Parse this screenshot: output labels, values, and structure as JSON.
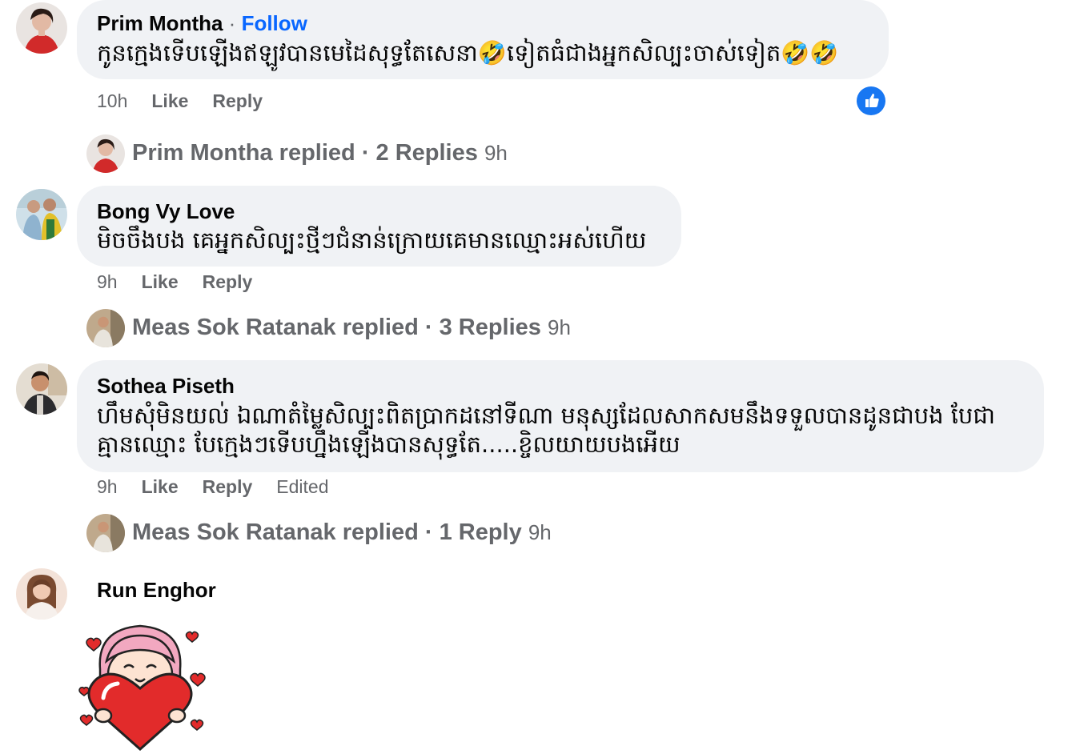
{
  "comments": [
    {
      "author": "Prim Montha",
      "follow_label": "Follow",
      "text": "កូនក្មេងទើបឡើងឥឡូវបានមេដៃសុទ្ធតែសេនា🤣ទៀតធំជាងអ្នកសិល្បះចាស់ទៀត🤣🤣",
      "time": "10h",
      "like_label": "Like",
      "reply_label": "Reply",
      "reaction": "like-icon",
      "replied_summary": "Prim Montha replied · 2 Replies",
      "replied_time": "9h"
    },
    {
      "author": "Bong Vy Love",
      "text": "មិចចឹងបង គេអ្នកសិល្បះថ្មីៗជំនាន់ក្រោយគេមានឈ្មោះអស់ហើយ",
      "time": "9h",
      "like_label": "Like",
      "reply_label": "Reply",
      "replied_summary": "Meas Sok Ratanak replied · 3 Replies",
      "replied_time": "9h"
    },
    {
      "author": "Sothea Piseth",
      "text_line1": "ហឹមសុំមិនយល់ ឯណាតំម្លៃសិល្បះពិតប្រាកដនៅទីណា មនុស្សដែលសាកសមនឹងទទួលបានដូនជាបង បែជា",
      "text_line2": "គ្មានឈ្មោះ បែក្មេងៗទើបហ្នឹងឡើងបានសុទ្ធតែ.....ខ្ចិលយាយបងអើយ",
      "time": "9h",
      "like_label": "Like",
      "reply_label": "Reply",
      "edited_label": "Edited",
      "replied_summary": "Meas Sok Ratanak replied · 1 Reply",
      "replied_time": "9h"
    },
    {
      "author": "Run Enghor",
      "sticker": "girl-hugging-heart-sticker"
    }
  ],
  "colors": {
    "bubble": "#f0f2f5",
    "link": "#0866ff",
    "meta": "#65676b",
    "like_blue": "#1877f2"
  }
}
